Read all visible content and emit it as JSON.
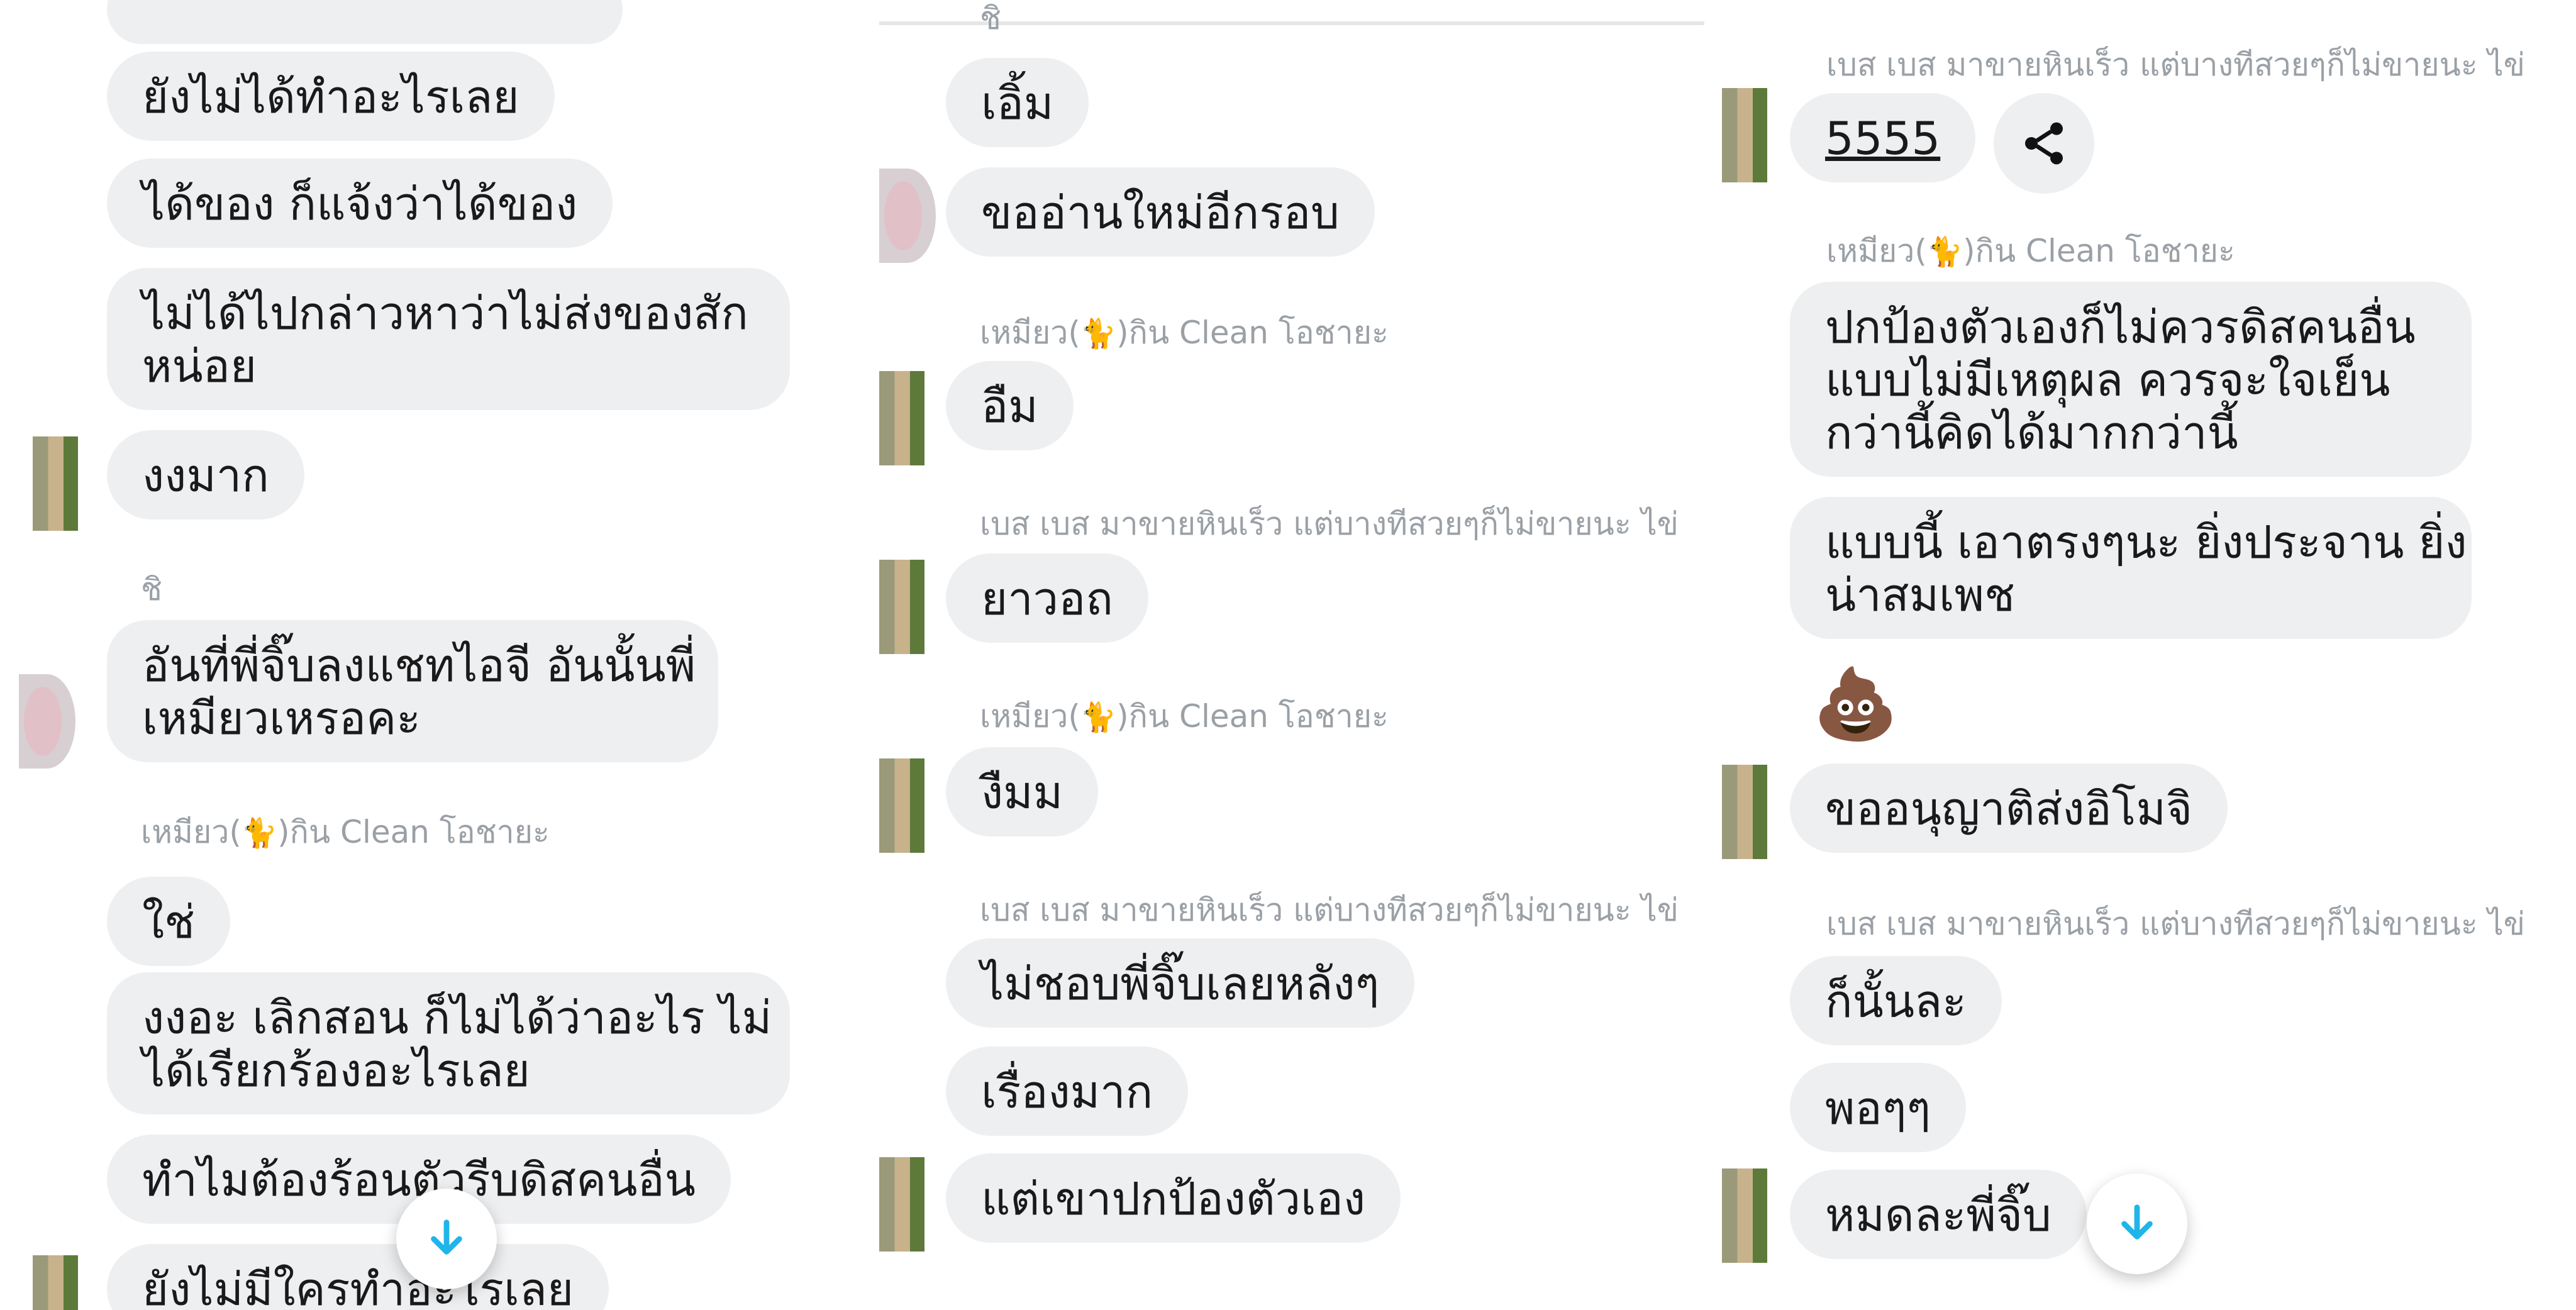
{
  "panels": [
    {
      "messages": [
        {
          "text": "ยังไม่ได้ทำอะไรเลย"
        },
        {
          "text": "ได้ของ ก็แจ้งว่าได้ของ"
        },
        {
          "text": "ไม่ได้ไปกล่าวหาว่าไม่ส่งของสัก",
          "text2": "หน่อย"
        },
        {
          "text": "งงมาก"
        },
        {
          "sender": "ชิ"
        },
        {
          "text": "อันที่พี่จิ๊บลงแชทไอจี อันนั้นพี่",
          "text2": "เหมียวเหรอคะ"
        },
        {
          "sender": "เหมียว(",
          "sender_suffix": ")กิน Clean โอชายะ"
        },
        {
          "text": "ใช่"
        },
        {
          "text": "งงอะ เลิกสอน ก็ไม่ได้ว่าอะไร ไม่",
          "text2": "ได้เรียกร้องอะไรเลย"
        },
        {
          "text": "ทำไมต้องร้อนตัวรีบดิสคนอื่น"
        },
        {
          "text": "ยังไม่มีใครทำอะไรเลย"
        }
      ]
    },
    {
      "messages": [
        {
          "sender": "ชิ"
        },
        {
          "text": "เอิ้ม"
        },
        {
          "text": "ขออ่านใหม่อีกรอบ"
        },
        {
          "sender": "เหมียว(",
          "sender_suffix": ")กิน Clean โอชายะ"
        },
        {
          "text": "อืม"
        },
        {
          "sender": "เบส เบส มาขายหินเร็ว แต่บางทีสวยๆก็ไม่ขายนะ ไข่"
        },
        {
          "text": "ยาวอถ"
        },
        {
          "sender": "เหมียว(",
          "sender_suffix": ")กิน Clean โอชายะ"
        },
        {
          "text": "งืมม"
        },
        {
          "sender": "เบส เบส มาขายหินเร็ว แต่บางทีสวยๆก็ไม่ขายนะ ไข่"
        },
        {
          "text": "ไม่ชอบพี่จิ๊บเลยหลังๆ"
        },
        {
          "text": "เรื่องมาก"
        },
        {
          "text": "แต่เขาปกป้องตัวเอง"
        }
      ]
    },
    {
      "messages": [
        {
          "sender": "เบส เบส มาขายหินเร็ว แต่บางทีสวยๆก็ไม่ขายนะ ไข่"
        },
        {
          "text": "5555"
        },
        {
          "sender": "เหมียว(",
          "sender_suffix": ")กิน Clean โอชายะ"
        },
        {
          "text": "ปกป้องตัวเองก็ไม่ควรดิสคนอื่น",
          "text2": "แบบไม่มีเหตุผล ควรจะใจเย็น",
          "text3": "กว่านี้คิดได้มากกว่านี้"
        },
        {
          "text": "แบบนี้ เอาตรงๆนะ ยิ่งประจาน ยิ่ง",
          "text2": "น่าสมเพช"
        },
        {
          "emoji": "💩"
        },
        {
          "text": "ขออนุญาติส่งอิโมจิ"
        },
        {
          "sender": "เบส เบส มาขายหินเร็ว แต่บางทีสวยๆก็ไม่ขายนะ ไข่"
        },
        {
          "text": "ก็นั้นละ"
        },
        {
          "text": "พอๆๆ"
        },
        {
          "text": "หมดละพี่จิ๊บ"
        }
      ]
    }
  ],
  "icons": {
    "cat": "🐈",
    "scroll_down": "arrow-down-icon",
    "share": "share-icon"
  },
  "colors": {
    "bubble_bg": "#eeeff1",
    "sender_text": "#9aa0a6",
    "fab_arrow": "#1fb5e8",
    "share_icon": "#111111"
  }
}
